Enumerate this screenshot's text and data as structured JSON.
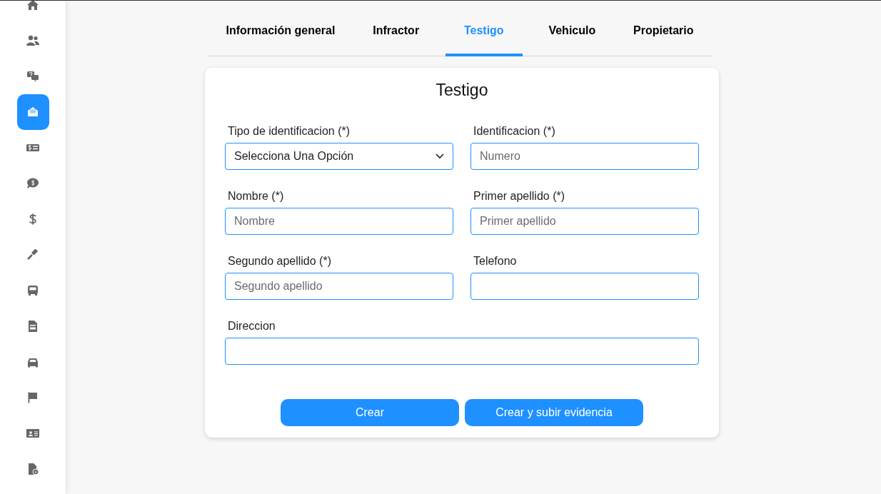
{
  "sidebar": {
    "items": [
      {
        "kind": "home",
        "selected": false
      },
      {
        "kind": "users",
        "selected": false
      },
      {
        "kind": "question-chat",
        "selected": false
      },
      {
        "kind": "inbox",
        "selected": true
      },
      {
        "kind": "money-card",
        "selected": false
      },
      {
        "kind": "money-chat",
        "selected": false
      },
      {
        "kind": "dollar",
        "selected": false
      },
      {
        "kind": "gavel",
        "selected": false
      },
      {
        "kind": "bus",
        "selected": false
      },
      {
        "kind": "document",
        "selected": false
      },
      {
        "kind": "car",
        "selected": false
      },
      {
        "kind": "flag",
        "selected": false
      },
      {
        "kind": "id-card",
        "selected": false
      },
      {
        "kind": "file-info",
        "selected": false
      }
    ]
  },
  "tabs": [
    {
      "label": "Información general",
      "selected": false
    },
    {
      "label": "Infractor",
      "selected": false
    },
    {
      "label": "Testigo",
      "selected": true
    },
    {
      "label": "Vehiculo",
      "selected": false
    },
    {
      "label": "Propietario",
      "selected": false
    }
  ],
  "form": {
    "title": "Testigo",
    "fields": [
      {
        "kind": "select",
        "label": "Tipo de identificacion (*)",
        "value": "Selecciona Una Opción"
      },
      {
        "kind": "text",
        "label": "Identificacion (*)",
        "placeholder": "Numero"
      },
      {
        "kind": "text",
        "label": "Nombre (*)",
        "placeholder": "Nombre"
      },
      {
        "kind": "text",
        "label": "Primer apellido (*)",
        "placeholder": "Primer apellido"
      },
      {
        "kind": "text",
        "label": "Segundo apellido (*)",
        "placeholder": "Segundo apellido"
      },
      {
        "kind": "text",
        "label": "Telefono"
      },
      {
        "kind": "wide",
        "label": "Direccion"
      }
    ],
    "buttons": [
      "Crear",
      "Crear y subir evidencia"
    ]
  }
}
